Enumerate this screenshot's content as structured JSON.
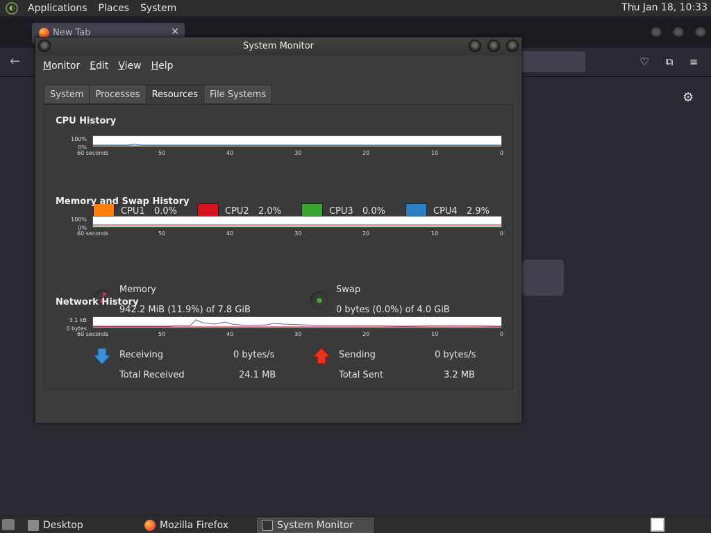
{
  "top_panel": {
    "menus": [
      "Applications",
      "Places",
      "System"
    ],
    "clock": "Thu Jan 18, 10:33"
  },
  "firefox": {
    "tab_title": "New Tab"
  },
  "window": {
    "title": "System Monitor",
    "menu": [
      {
        "label": "Monitor",
        "underline": "M"
      },
      {
        "label": "Edit",
        "underline": "E"
      },
      {
        "label": "View",
        "underline": "V"
      },
      {
        "label": "Help",
        "underline": "H"
      }
    ],
    "tabs": [
      "System",
      "Processes",
      "Resources",
      "File Systems"
    ],
    "active_tab": "Resources"
  },
  "cpu": {
    "title": "CPU History",
    "y_max": "100%",
    "y_min": "0%",
    "x_labels": [
      "60 seconds",
      "50",
      "40",
      "30",
      "20",
      "10",
      "0"
    ],
    "items": [
      {
        "name": "CPU1",
        "value": "0.0%",
        "color": "#ff7f0e"
      },
      {
        "name": "CPU2",
        "value": "2.0%",
        "color": "#d7141e"
      },
      {
        "name": "CPU3",
        "value": "0.0%",
        "color": "#3aa52e"
      },
      {
        "name": "CPU4",
        "value": "2.9%",
        "color": "#2c7fc1"
      }
    ]
  },
  "memory": {
    "title": "Memory and Swap History",
    "y_max": "100%",
    "y_min": "0%",
    "x_labels": [
      "60 seconds",
      "50",
      "40",
      "30",
      "20",
      "10",
      "0"
    ],
    "memory_label": "Memory",
    "memory_value": "942.2 MiB (11.9%) of 7.8 GiB",
    "memory_color": "#c3296a",
    "swap_label": "Swap",
    "swap_value": "0 bytes (0.0%) of 4.0 GiB",
    "swap_color": "#4ea72e"
  },
  "network": {
    "title": "Network History",
    "y_max": "3.1 kB",
    "y_min": "0 bytes",
    "x_labels": [
      "60 seconds",
      "50",
      "40",
      "30",
      "20",
      "10",
      "0"
    ],
    "receiving_label": "Receiving",
    "receiving_value": "0 bytes/s",
    "total_received_label": "Total Received",
    "total_received_value": "24.1 MB",
    "sending_label": "Sending",
    "sending_value": "0 bytes/s",
    "total_sent_label": "Total Sent",
    "total_sent_value": "3.2 MB"
  },
  "taskbar": {
    "items": [
      "Desktop",
      "Mozilla Firefox",
      "System Monitor"
    ]
  }
}
